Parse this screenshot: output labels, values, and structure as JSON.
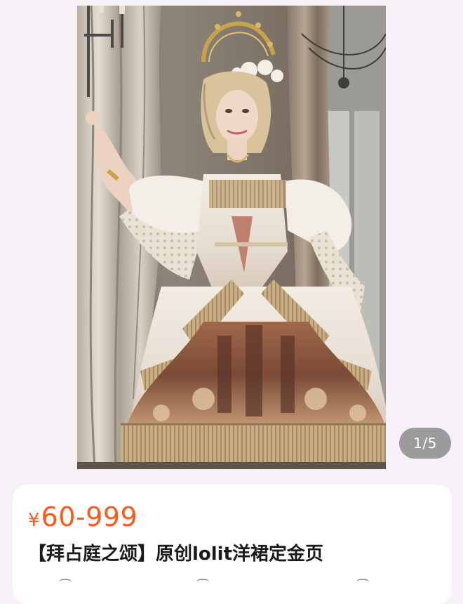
{
  "gallery": {
    "counter": "1/5",
    "image_description_icon": "product-photo"
  },
  "product": {
    "currency": "¥",
    "price": "60-999",
    "title": "【拜占庭之颂】原创lolit洋裙定金页"
  },
  "colors": {
    "page_background": "#f5f1f6",
    "price_color": "#ff5a1a",
    "title_color": "#1a1a1a",
    "counter_background": "#787878"
  }
}
